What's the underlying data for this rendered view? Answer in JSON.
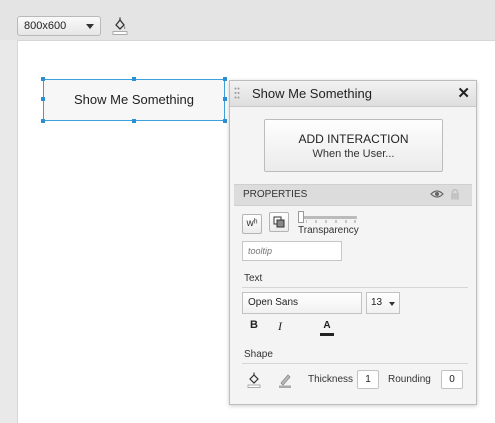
{
  "toolbar": {
    "canvas_size": "800x600",
    "fill_icon": "paint-bucket-icon"
  },
  "widget": {
    "label": "Show Me Something"
  },
  "panel": {
    "title": "Show Me Something",
    "close_icon": "close-icon",
    "add_interaction": {
      "main": "ADD INTERACTION",
      "sub": "When the User..."
    },
    "properties": {
      "label": "PROPERTIES",
      "visibility_icon": "eye-icon",
      "lock_icon": "lock-icon",
      "size_button": "wʰ",
      "transparency_label": "Transparency",
      "transparency_value": 0,
      "tooltip_placeholder": "tooltip"
    },
    "text": {
      "label": "Text",
      "font": "Open Sans",
      "size": "13",
      "bold": "B",
      "italic": "I",
      "color_glyph": "A",
      "color": "#222222"
    },
    "shape": {
      "label": "Shape",
      "thickness_label": "Thickness",
      "thickness_value": "1",
      "rounding_label": "Rounding",
      "rounding_value": "0"
    }
  },
  "colors": {
    "selection": "#2b8fd3"
  }
}
